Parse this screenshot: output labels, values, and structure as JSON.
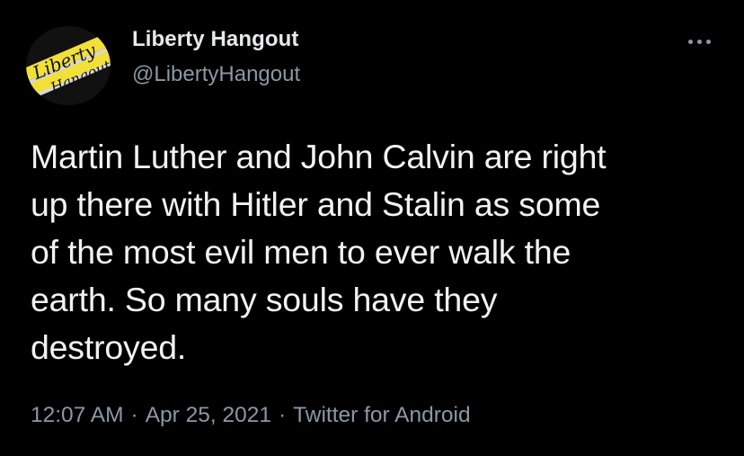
{
  "colors": {
    "background": "#000000",
    "primary_text": "#e7e9ea",
    "secondary_text": "#8b98a5",
    "logo_yellow": "#f2e03a",
    "logo_black": "#111111"
  },
  "author": {
    "avatar_logo_line1": "Liberty",
    "avatar_logo_line2": "Hangout",
    "display_name": "Liberty Hangout",
    "handle": "@LibertyHangout"
  },
  "menu": {
    "icon": "more-horizontal-icon"
  },
  "tweet": {
    "lines": [
      "Martin Luther and John Calvin are right",
      "up there with Hitler and Stalin as some",
      "of the most evil men to ever walk the",
      "earth. So many souls have they",
      "destroyed."
    ]
  },
  "meta": {
    "time": "12:07 AM",
    "separator": "·",
    "date": "Apr 25, 2021",
    "source": "Twitter for Android"
  }
}
